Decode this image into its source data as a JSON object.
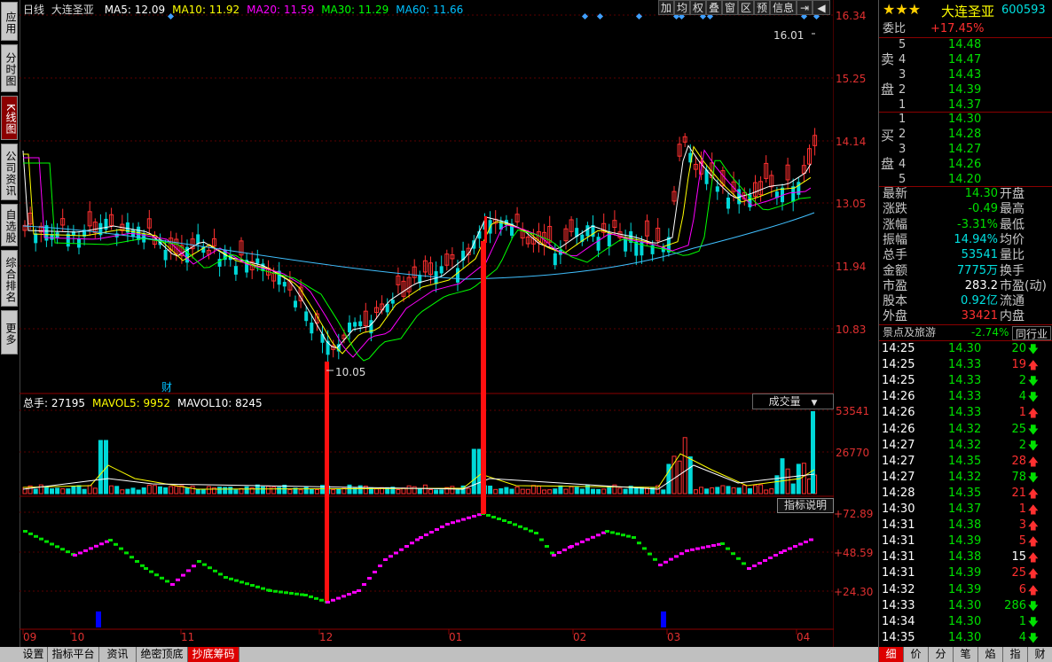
{
  "left_tabs": [
    {
      "label": "应用"
    },
    {
      "label": "分时图"
    },
    {
      "label": "K线图",
      "active": true
    },
    {
      "label": "公司资讯"
    },
    {
      "label": "自选股"
    },
    {
      "label": "综合排名"
    },
    {
      "label": "更多"
    }
  ],
  "kline_header": {
    "period": "日线",
    "name": "大连圣亚",
    "ma": [
      {
        "label": "MA5: 12.09",
        "color": "#ffffff"
      },
      {
        "label": "MA10: 11.92",
        "color": "#ffff00"
      },
      {
        "label": "MA20: 11.59",
        "color": "#ff00ff"
      },
      {
        "label": "MA30: 11.29",
        "color": "#00ff00"
      },
      {
        "label": "MA60: 11.66",
        "color": "#00c0ff"
      }
    ]
  },
  "top_buttons": [
    "加",
    "均",
    "权",
    "叠",
    "窗",
    "区",
    "预",
    "信息",
    "⇥",
    "◀"
  ],
  "price_axis": [
    "16.34",
    "15.25",
    "14.14",
    "13.05",
    "11.94",
    "10.83"
  ],
  "annotations": {
    "high": "16.01",
    "low": "10.05",
    "cai": "财"
  },
  "volume_header": {
    "items": [
      {
        "label": "总手: 27195",
        "color": "#ffffff"
      },
      {
        "label": "MAVOL5: 9952",
        "color": "#ffff00"
      },
      {
        "label": "MAVOL10: 8245",
        "color": "#ffffff"
      }
    ],
    "dropdown": "成交量"
  },
  "volume_axis": [
    "53541",
    "26770"
  ],
  "indicator": {
    "button": "指标说明",
    "axis": [
      "+72.89",
      "+48.59",
      "+24.30"
    ]
  },
  "date_axis": [
    "09",
    "10",
    "11",
    "12",
    "01",
    "02",
    "03",
    "04"
  ],
  "bottom_tabs": [
    {
      "label": "设置"
    },
    {
      "label": "指标平台"
    },
    {
      "label": "资讯"
    },
    {
      "label": "绝密顶底"
    },
    {
      "label": "抄底筹码",
      "active": true
    }
  ],
  "right_panel": {
    "stars": "★★★",
    "name": "大连圣亚",
    "code": "600593",
    "weibi_label": "委比",
    "weibi": "+17.45%",
    "sell_label": [
      "卖",
      "盘"
    ],
    "buy_label": [
      "买",
      "盘"
    ],
    "sells": [
      {
        "n": "5",
        "p": "14.48"
      },
      {
        "n": "4",
        "p": "14.47"
      },
      {
        "n": "3",
        "p": "14.43"
      },
      {
        "n": "2",
        "p": "14.39"
      },
      {
        "n": "1",
        "p": "14.37"
      }
    ],
    "buys": [
      {
        "n": "1",
        "p": "14.30"
      },
      {
        "n": "2",
        "p": "14.28"
      },
      {
        "n": "3",
        "p": "14.27"
      },
      {
        "n": "4",
        "p": "14.26"
      },
      {
        "n": "5",
        "p": "14.20"
      }
    ],
    "stats": [
      {
        "l": "最新",
        "v": "14.30",
        "vc": "c-green",
        "l2": "开盘"
      },
      {
        "l": "涨跌",
        "v": "-0.49",
        "vc": "c-green",
        "l2": "最高"
      },
      {
        "l": "涨幅",
        "v": "-3.31%",
        "vc": "c-green",
        "l2": "最低"
      },
      {
        "l": "振幅",
        "v": "14.94%",
        "vc": "c-cyan",
        "l2": "均价"
      },
      {
        "l": "总手",
        "v": "53541",
        "vc": "c-cyan",
        "l2": "量比"
      },
      {
        "l": "金额",
        "v": "7775万",
        "vc": "c-cyan",
        "l2": "换手"
      },
      {
        "l": "市盈",
        "v": "283.2",
        "vc": "c-white",
        "l2": "市盈(动)"
      },
      {
        "l": "股本",
        "v": "0.92亿",
        "vc": "c-cyan",
        "l2": "流通"
      },
      {
        "l": "外盘",
        "v": "33421",
        "vc": "c-red",
        "l2": "内盘"
      }
    ],
    "sector_name": "景点及旅游",
    "sector_change": "-2.74%",
    "peer_button": "同行业",
    "ticks": [
      {
        "t": "14:25",
        "p": "14.30",
        "v": "20",
        "d": "down"
      },
      {
        "t": "14:25",
        "p": "14.33",
        "v": "19",
        "d": "up"
      },
      {
        "t": "14:25",
        "p": "14.33",
        "v": "2",
        "d": "down"
      },
      {
        "t": "14:26",
        "p": "14.33",
        "v": "4",
        "d": "down"
      },
      {
        "t": "14:26",
        "p": "14.33",
        "v": "1",
        "d": "up"
      },
      {
        "t": "14:26",
        "p": "14.32",
        "v": "25",
        "d": "down"
      },
      {
        "t": "14:27",
        "p": "14.32",
        "v": "2",
        "d": "down"
      },
      {
        "t": "14:27",
        "p": "14.35",
        "v": "28",
        "d": "up"
      },
      {
        "t": "14:27",
        "p": "14.32",
        "v": "78",
        "d": "down"
      },
      {
        "t": "14:28",
        "p": "14.35",
        "v": "21",
        "d": "up"
      },
      {
        "t": "14:30",
        "p": "14.37",
        "v": "1",
        "d": "up"
      },
      {
        "t": "14:31",
        "p": "14.38",
        "v": "3",
        "d": "up"
      },
      {
        "t": "14:31",
        "p": "14.39",
        "v": "5",
        "d": "up"
      },
      {
        "t": "14:31",
        "p": "14.38",
        "v": "15",
        "d": "up",
        "white": true
      },
      {
        "t": "14:31",
        "p": "14.39",
        "v": "25",
        "d": "up"
      },
      {
        "t": "14:32",
        "p": "14.39",
        "v": "6",
        "d": "up"
      },
      {
        "t": "14:33",
        "p": "14.30",
        "v": "286",
        "d": "down"
      },
      {
        "t": "14:34",
        "p": "14.30",
        "v": "1",
        "d": "down"
      },
      {
        "t": "14:35",
        "p": "14.30",
        "v": "4",
        "d": "down"
      }
    ],
    "bottom_tabs": [
      "细",
      "价",
      "分",
      "笔",
      "焰",
      "指",
      "财"
    ]
  }
}
